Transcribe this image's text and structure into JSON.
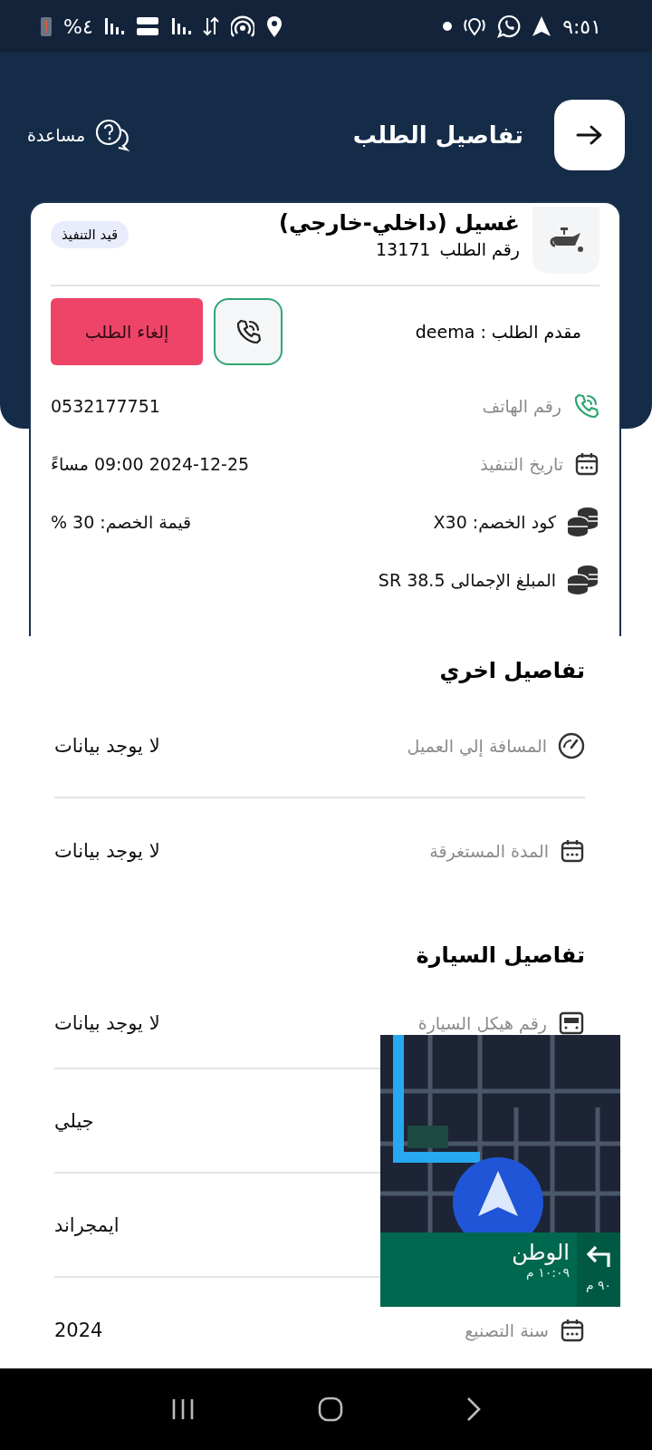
{
  "status_bar": {
    "battery": "%٤",
    "time": "٩:٥١"
  },
  "header": {
    "title": "تفاصيل الطلب",
    "help": "مساعدة"
  },
  "order": {
    "service": "غسيل (داخلي-خارجي)",
    "order_label": "رقم الطلب",
    "order_number": "13171",
    "status_badge": "قيد التنفيذ",
    "requester": "مقدم الطلب : deema",
    "cancel_button": "إلغاء الطلب",
    "info": [
      {
        "kind": "phone",
        "label": "رقم الهاتف",
        "value": "0532177751"
      },
      {
        "kind": "date",
        "label": "تاريخ التنفيذ",
        "value": "2024-12-25 09:00 مساءً"
      },
      {
        "kind": "coins",
        "text": "كود الخصم: X30",
        "value": "قيمة الخصم: 30 %"
      },
      {
        "kind": "coins",
        "text": "المبلغ الإجمالى SR 38.5"
      }
    ]
  },
  "other_details": {
    "title": "تفاصيل اخري",
    "rows": [
      {
        "kind": "gauge",
        "label": "المسافة إلي العميل",
        "value": "لا يوجد بيانات"
      },
      {
        "kind": "calendar",
        "label": "المدة المستغرقة",
        "value": "لا يوجد بيانات"
      }
    ]
  },
  "car_details": {
    "title": "تفاصيل السيارة",
    "rows": [
      {
        "kind": "plate",
        "label": "رقم هيكل السيارة",
        "value": "لا يوجد بيانات"
      },
      {
        "value": "جيلي"
      },
      {
        "value": "ايمجراند"
      },
      {
        "kind": "calendar",
        "label": "سنة التصنيع",
        "value": "2024"
      }
    ]
  },
  "map_overlay": {
    "kind": "picture",
    "street": "الوطن",
    "distance": "٩٠ م",
    "eta": "١٠:٠٩ م"
  }
}
